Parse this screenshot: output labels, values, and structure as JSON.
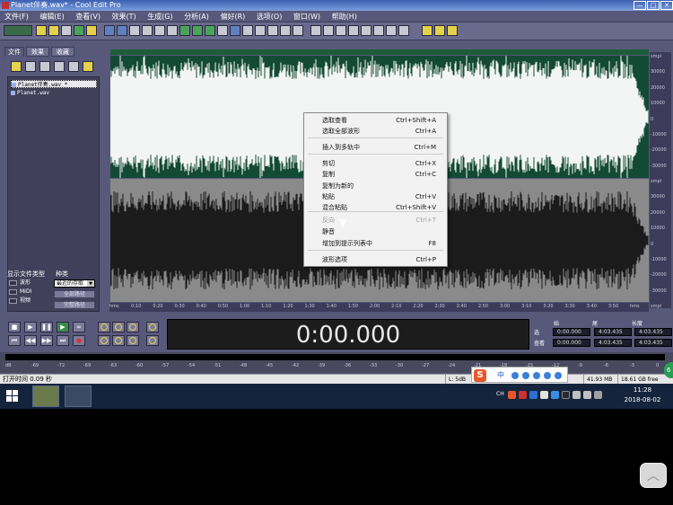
{
  "window": {
    "title": "Planet伴奏.wav* - Cool Edit Pro",
    "controls": [
      "—",
      "□",
      "✕"
    ]
  },
  "menu": [
    "文件(F)",
    "编辑(E)",
    "查看(V)",
    "效果(T)",
    "生成(G)",
    "分析(A)",
    "偏好(R)",
    "选项(O)",
    "窗口(W)",
    "帮助(H)"
  ],
  "left_panel": {
    "tabs": [
      "文件",
      "效果",
      "收藏"
    ],
    "files": [
      "Planet伴奏.wav *",
      "Planet.wav"
    ],
    "show_file_type": "显示文件类型",
    "sort_label": "种类",
    "types": [
      "波形",
      "MIDI",
      "视频"
    ],
    "sort_value": "最近的存取",
    "btn_full_path": "全部路径",
    "btn_auto_play": "完整路径"
  },
  "amplitude_ticks": [
    "smpl",
    "30000",
    "20000",
    "10000",
    "0",
    "-10000",
    "-20000",
    "-30000",
    "smpl",
    "30000",
    "20000",
    "10000",
    "0",
    "-10000",
    "-20000",
    "-30000",
    "smpl"
  ],
  "time_ticks": [
    "hms",
    "0:10",
    "0:20",
    "0:30",
    "0:40",
    "0:50",
    "1:00",
    "1:10",
    "1:20",
    "1:30",
    "1:40",
    "1:50",
    "2:00",
    "2:10",
    "2:20",
    "2:30",
    "2:40",
    "2:50",
    "3:00",
    "3:10",
    "3:20",
    "3:30",
    "3:40",
    "3:50",
    "hms"
  ],
  "colors": {
    "channel_left": "#134a35",
    "channel_right": "#8a8a8a",
    "wave_left": "#ffffff",
    "wave_right": "#101010"
  },
  "context_menu": {
    "items": [
      {
        "label": "选取查看",
        "shortcut": "Ctrl+Shift+A",
        "enabled": true
      },
      {
        "label": "选取全部波形",
        "shortcut": "Ctrl+A",
        "enabled": true
      },
      {
        "label": "插入到多轨中",
        "shortcut": "Ctrl+M",
        "enabled": true
      },
      {
        "label": "剪切",
        "shortcut": "Ctrl+X",
        "enabled": true
      },
      {
        "label": "复制",
        "shortcut": "Ctrl+C",
        "enabled": true
      },
      {
        "label": "复制为新的",
        "shortcut": "",
        "enabled": true
      },
      {
        "label": "粘贴",
        "shortcut": "Ctrl+V",
        "enabled": true
      },
      {
        "label": "混合粘贴",
        "shortcut": "Ctrl+Shift+V",
        "enabled": true
      },
      {
        "label": "反向",
        "shortcut": "Ctrl+T",
        "enabled": false
      },
      {
        "label": "静音",
        "shortcut": "",
        "enabled": true
      },
      {
        "label": "增加到提示列表中",
        "shortcut": "F8",
        "enabled": true
      },
      {
        "label": "波形选项",
        "shortcut": "Ctrl+P",
        "enabled": true
      }
    ]
  },
  "transport": {
    "buttons": [
      "■",
      "▶",
      "❚❚",
      "▶",
      "∞",
      "⏮",
      "◀◀",
      "▶▶",
      "⏭",
      "●"
    ]
  },
  "time_display": "0:00.000",
  "selection_info": {
    "headers": [
      "始",
      "尾",
      "长度"
    ],
    "row1_label": "选",
    "row2_label": "查看",
    "begin_sel": "0:00.000",
    "end_sel": "4:03.435",
    "len_sel": "4:03.435",
    "begin_view": "0:00.000",
    "end_view": "4:03.435",
    "len_view": "4:03.435"
  },
  "level_ticks": [
    "dB",
    "-69",
    "-72",
    "-69",
    "-63",
    "-60",
    "-57",
    "-54",
    "-51",
    "-48",
    "-45",
    "-42",
    "-39",
    "-36",
    "-33",
    "-30",
    "-27",
    "-24",
    "-21",
    "-18",
    "-15",
    "-12",
    "-9",
    "-6",
    "-3",
    "0"
  ],
  "status": {
    "open_time": "打开时间  0.09 秒",
    "cell2": "L: 5dB",
    "size": "41.93 MB",
    "free": "18.61 GB free"
  },
  "ime": {
    "logo": "S",
    "lang": "中"
  },
  "tray": {
    "lang": "CH",
    "time": "11:28",
    "date": "2018-08-02"
  },
  "bubble": "6"
}
